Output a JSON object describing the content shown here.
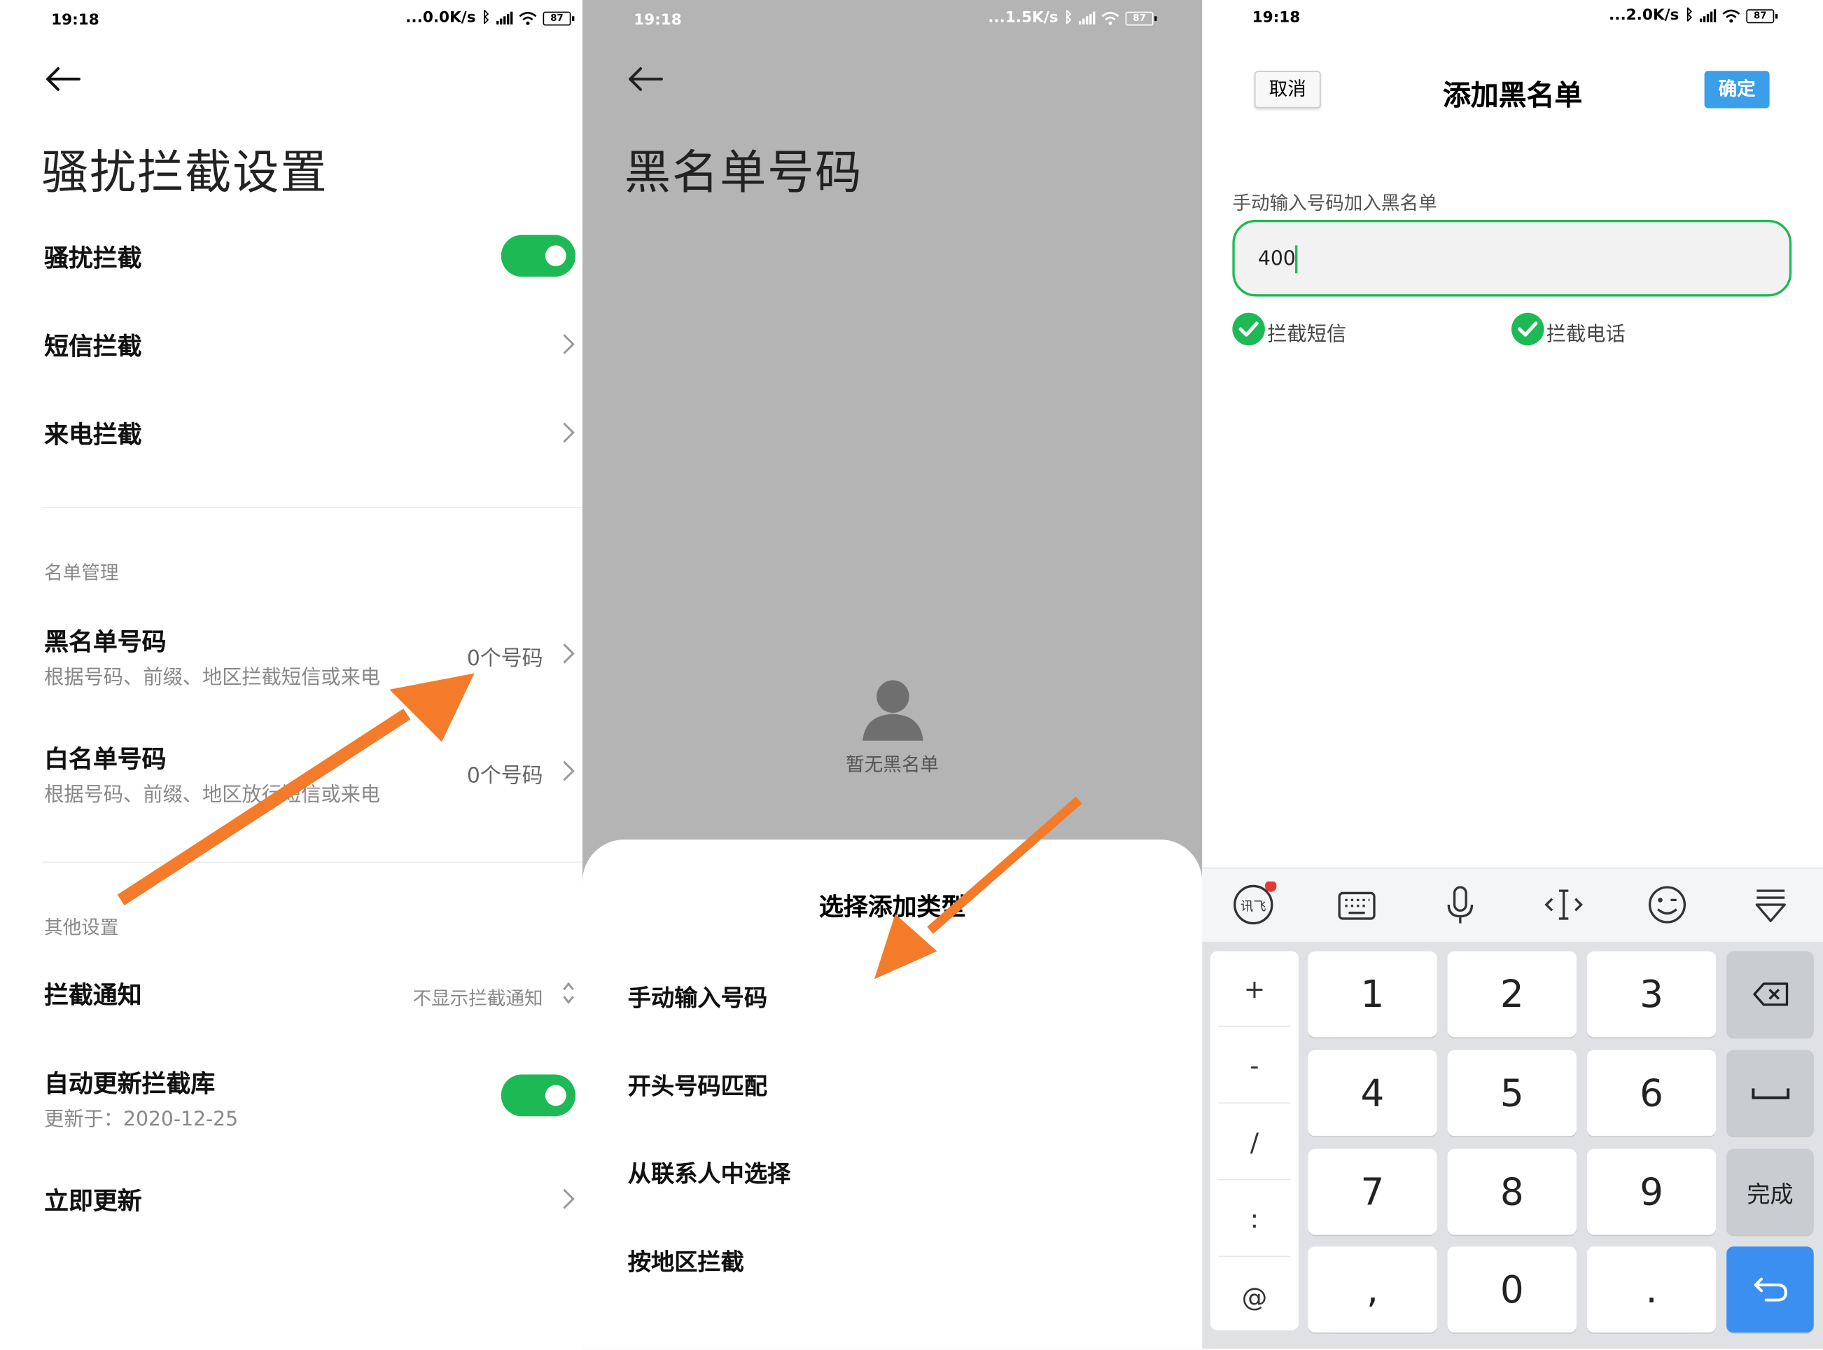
{
  "screen1": {
    "status": {
      "time": "19:18",
      "speed": "...0.0K/s",
      "battery": "87"
    },
    "title": "骚扰拦截设置",
    "rows": {
      "harass": "骚扰拦截",
      "sms": "短信拦截",
      "call": "来电拦截"
    },
    "section_list": "名单管理",
    "blacklist": {
      "label": "黑名单号码",
      "sub": "根据号码、前缀、地区拦截短信或来电",
      "count": "0个号码"
    },
    "whitelist": {
      "label": "白名单号码",
      "sub": "根据号码、前缀、地区放行短信或来电",
      "count": "0个号码"
    },
    "section_other": "其他设置",
    "notify": {
      "label": "拦截通知",
      "value": "不显示拦截通知"
    },
    "autoupdate": {
      "label": "自动更新拦截库",
      "sub": "更新于：2020-12-25"
    },
    "update_now": "立即更新"
  },
  "screen2": {
    "status": {
      "time": "19:18",
      "speed": "...1.5K/s",
      "battery": "87"
    },
    "title": "黑名单号码",
    "empty": "暂无黑名单",
    "sheet_title": "选择添加类型",
    "options": [
      "手动输入号码",
      "开头号码匹配",
      "从联系人中选择",
      "按地区拦截"
    ]
  },
  "screen3": {
    "status": {
      "time": "19:18",
      "speed": "...2.0K/s",
      "battery": "87"
    },
    "cancel": "取消",
    "title": "添加黑名单",
    "confirm": "确定",
    "field_label": "手动输入号码加入黑名单",
    "field_value": "400",
    "opt_sms": "拦截短信",
    "opt_call": "拦截电话",
    "keyboard": {
      "symbols": [
        "+",
        "-",
        "/",
        ":",
        "@"
      ],
      "digits": [
        "1",
        "2",
        "3",
        "4",
        "5",
        "6",
        "7",
        "8",
        "9",
        ",",
        "0",
        "."
      ],
      "done": "完成",
      "toolbar": [
        "ifly-logo-icon",
        "keyboard-icon",
        "microphone-icon",
        "cursor-icon",
        "emoji-icon",
        "collapse-keyboard-icon"
      ]
    }
  },
  "colors": {
    "accent_green": "#1db954",
    "confirm_blue": "#3a9ee8",
    "arrow_orange": "#f47b2a",
    "enter_blue": "#3b8ff0"
  }
}
